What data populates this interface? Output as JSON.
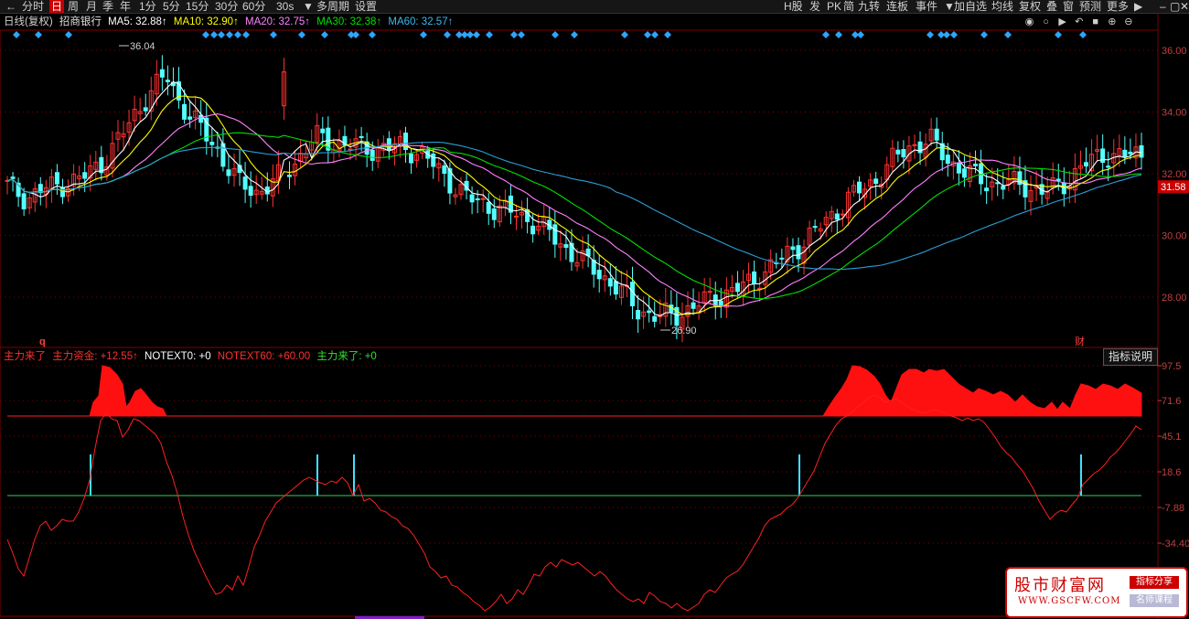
{
  "toolbar": {
    "items": [
      "分时",
      "日",
      "周",
      "月",
      "季",
      "年",
      "1分",
      "5分",
      "15分",
      "30分",
      "60分",
      "30s",
      "▼",
      "多周期",
      "设置"
    ],
    "right_items": [
      "H股",
      "发",
      "PK",
      "简",
      "九转",
      "连板",
      "事件",
      "▼",
      "加自选",
      "均线",
      "复权",
      "叠",
      "窗",
      "预测",
      "更多",
      "▶"
    ],
    "active": "日"
  },
  "chart_info": {
    "period": "日线(复权)",
    "stock": "招商银行",
    "ma5": "MA5: 32.88↑",
    "ma10": "MA10: 32.90↑",
    "ma20": "MA20: 32.75↑",
    "ma30": "MA30: 32.38↑",
    "ma60": "MA60: 32.57↑"
  },
  "colors": {
    "up": "#ff3232",
    "down": "#54ffff",
    "ma5": "#ffffff",
    "ma10": "#ffff00",
    "ma20": "#ff80ff",
    "ma30": "#00e000",
    "ma60": "#2a9fd6",
    "grid": "#800000",
    "ind_line": "#ff2020"
  },
  "price_axis": {
    "labels": [
      "36.00",
      "34.00",
      "32.00",
      "30.00",
      "28.00"
    ],
    "current": "31.58"
  },
  "price_annotations": {
    "high": "36.04",
    "low": "26.90",
    "event_q": "q",
    "event_cai": "财"
  },
  "indicator_info": {
    "name": "主力来了",
    "fund_label": "主力资金: +12.55↑",
    "notext0": "NOTEXT0: +0",
    "notext60": "NOTEXT60: +60.00",
    "main_arrive": "主力来了: +0"
  },
  "indicator_axis": {
    "labels": [
      "97.5",
      "71.6",
      "45.1",
      "18.6",
      "-7.88",
      "-34.40"
    ]
  },
  "indicator_help": "指标说明",
  "right_icons": [
    "eye-icon",
    "circle-icon",
    "play-icon",
    "undo-icon",
    "lock-icon",
    "zoom-in-icon",
    "zoom-out-icon"
  ],
  "watermark": {
    "title": "股市财富网",
    "url": "WWW.GSCFW.COM",
    "badge1": "指标分享",
    "badge2": "名师课程"
  }
}
